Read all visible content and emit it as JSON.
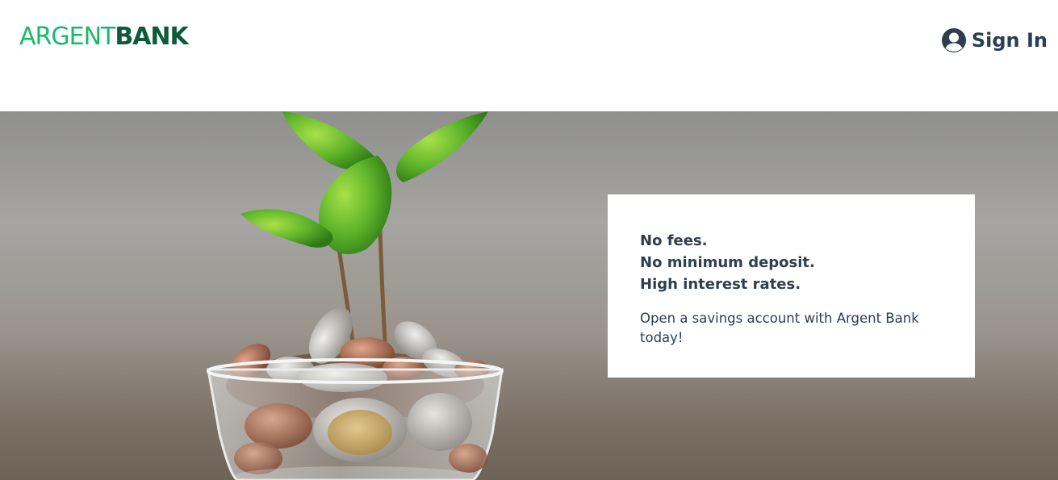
{
  "header": {
    "logo": {
      "part1": "ARGENT",
      "part2": "BANK",
      "colors": {
        "part1": "#19b96b",
        "part2": "#0e5a3a"
      }
    },
    "sign_in": {
      "icon": "user-circle-icon",
      "label": "Sign In"
    }
  },
  "hero": {
    "image": "coins-jar-with-sprouting-plant",
    "subtitles": [
      "No fees.",
      "No minimum deposit.",
      "High interest rates."
    ],
    "text": "Open a savings account with Argent Bank today!"
  }
}
